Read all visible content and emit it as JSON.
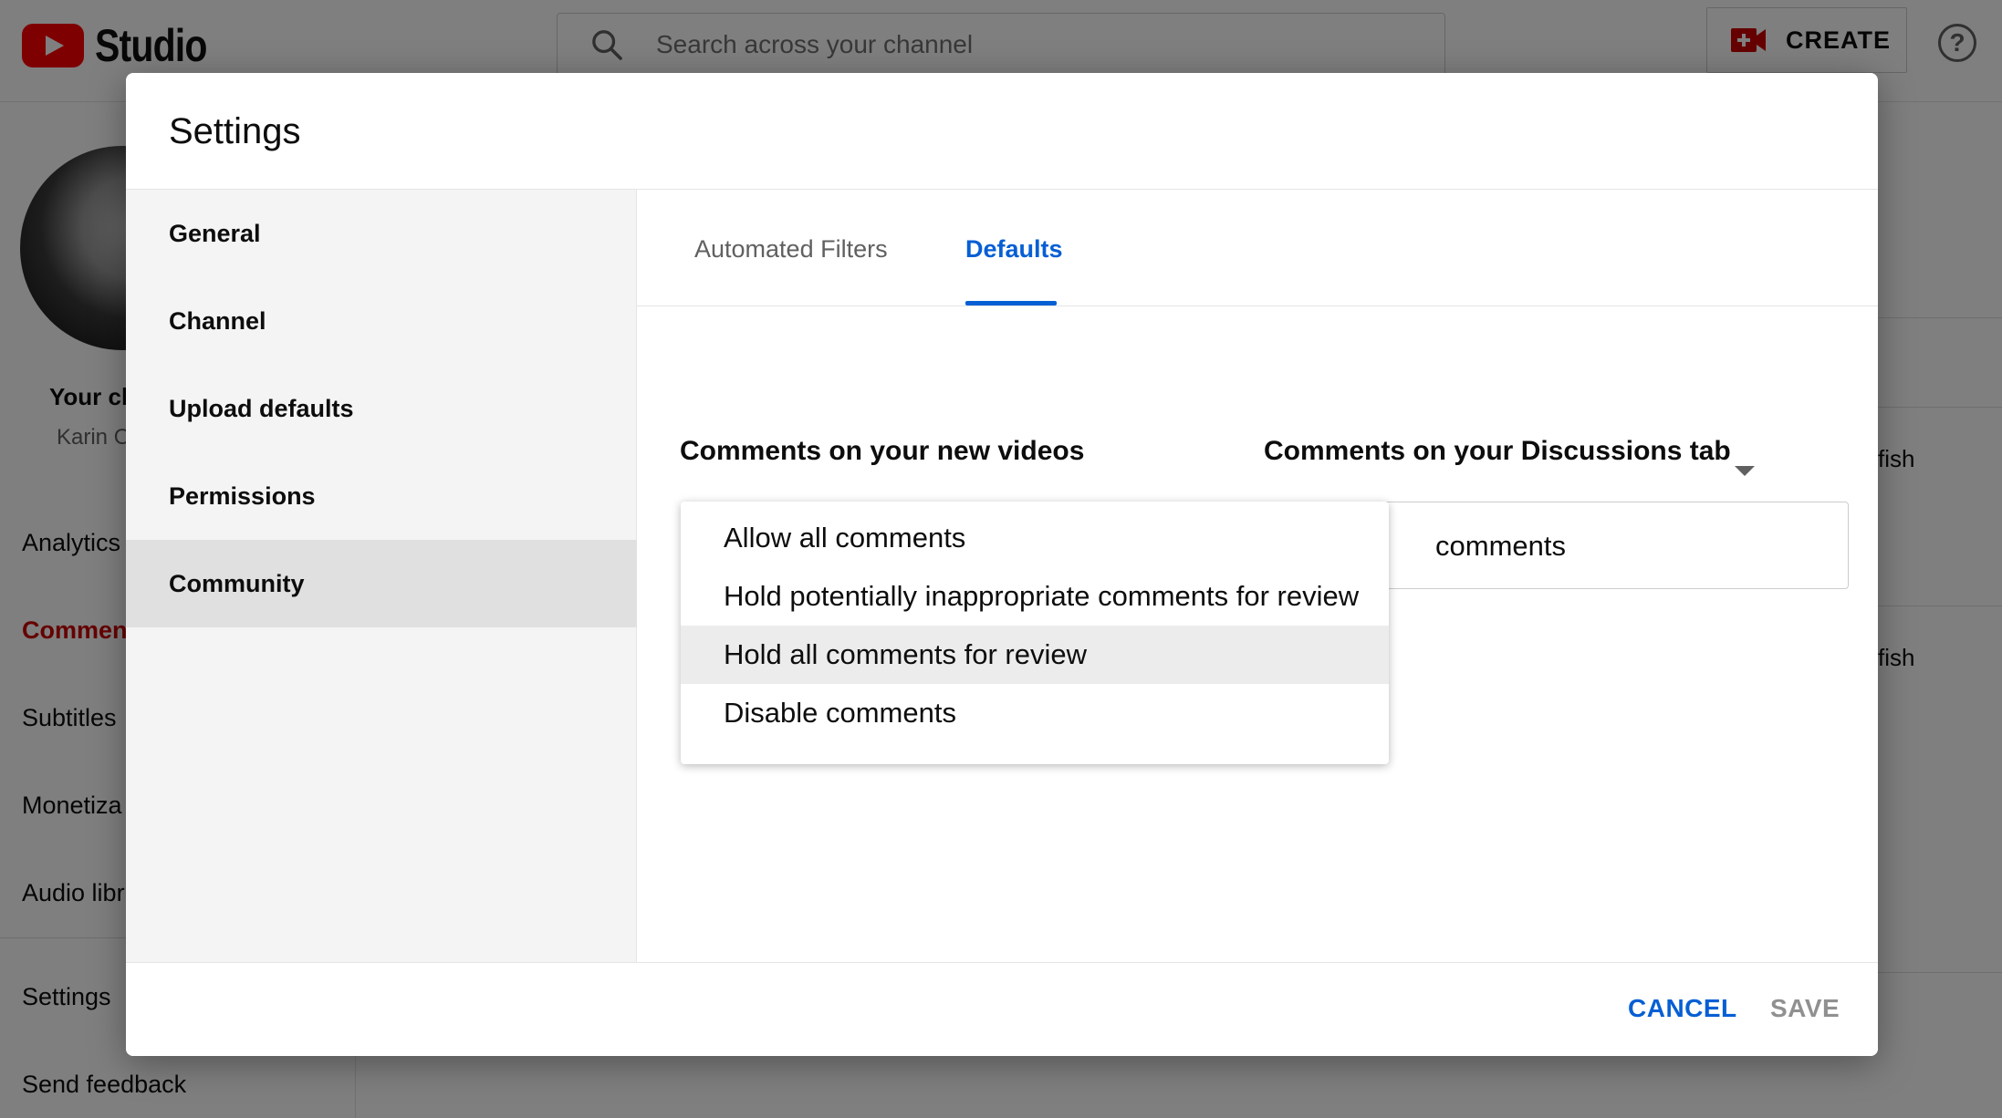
{
  "app": {
    "logo_text": "Studio",
    "search_placeholder": "Search across your channel",
    "create_label": "CREATE",
    "help_glyph": "?"
  },
  "sidebar": {
    "channel_title": "Your ch",
    "channel_name": "Karin O",
    "items": [
      {
        "label": "Analytics",
        "active": false
      },
      {
        "label": "Comments",
        "active": true
      },
      {
        "label": "Subtitles",
        "active": false
      },
      {
        "label": "Monetiza",
        "active": false
      },
      {
        "label": "Audio libr",
        "active": false
      },
      {
        "label": "Settings",
        "active": false
      },
      {
        "label": "Send feedback",
        "active": false
      }
    ]
  },
  "background": {
    "row_texts": [
      "fish",
      "fish"
    ]
  },
  "dialog": {
    "title": "Settings",
    "nav": [
      {
        "label": "General",
        "selected": false
      },
      {
        "label": "Channel",
        "selected": false
      },
      {
        "label": "Upload defaults",
        "selected": false
      },
      {
        "label": "Permissions",
        "selected": false
      },
      {
        "label": "Community",
        "selected": true
      }
    ],
    "tabs": [
      {
        "label": "Automated Filters",
        "active": false
      },
      {
        "label": "Defaults",
        "active": true
      }
    ],
    "new_videos": {
      "label": "Comments on your new videos",
      "options": [
        "Allow all comments",
        "Hold potentially inappropriate comments for review",
        "Hold all comments for review",
        "Disable comments"
      ],
      "highlighted_option": "Hold all comments for review"
    },
    "discussions": {
      "label": "Comments on your Discussions tab",
      "selected_value_visible": "comments"
    },
    "cancel_label": "CANCEL",
    "save_label": "SAVE"
  },
  "colors": {
    "accent": "#065fd4",
    "brand_red": "#ff0000",
    "active_nav_red": "#cc0000",
    "disabled_text": "#909090"
  },
  "icons": [
    "youtube-logo-icon",
    "search-icon",
    "create-video-icon",
    "help-icon",
    "dropdown-caret-icon"
  ]
}
